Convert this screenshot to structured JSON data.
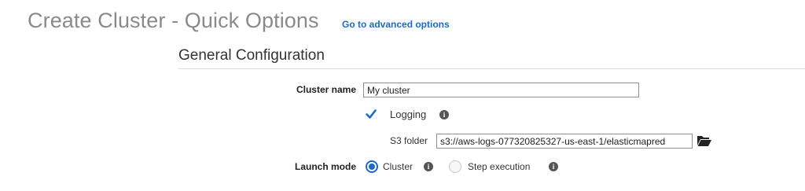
{
  "header": {
    "title": "Create Cluster - Quick Options",
    "advanced_link": "Go to advanced options"
  },
  "general": {
    "title": "General Configuration",
    "cluster_name": {
      "label": "Cluster name",
      "value": "My cluster"
    },
    "logging": {
      "label": "Logging",
      "checked": true,
      "info_icon": "info-icon"
    },
    "s3_folder": {
      "label": "S3 folder",
      "value": "s3://aws-logs-077320825327-us-east-1/elasticmapred",
      "browse_icon": "folder-open-icon"
    },
    "launch_mode": {
      "label": "Launch mode",
      "options": [
        {
          "label": "Cluster",
          "selected": true
        },
        {
          "label": "Step execution",
          "selected": false
        }
      ]
    }
  },
  "colors": {
    "accent": "#1b6ac9",
    "title_gray": "#8a8a8a"
  }
}
